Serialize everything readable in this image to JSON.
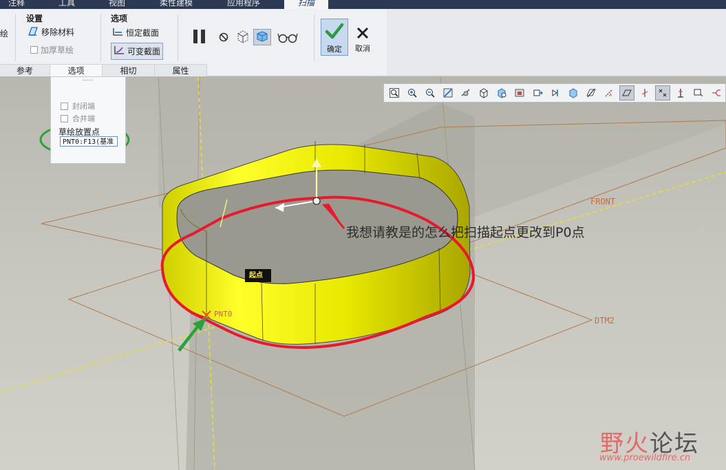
{
  "top_menu": [
    {
      "label": "注释",
      "active": false
    },
    {
      "label": "工具",
      "active": false
    },
    {
      "label": "视图",
      "active": false
    },
    {
      "label": "柔性建模",
      "active": false
    },
    {
      "label": "应用程序",
      "active": false
    },
    {
      "label": "扫描",
      "active": true
    }
  ],
  "ribbon": {
    "left_fragment": "绘",
    "settings": {
      "title": "设置",
      "remove_material": "移除材料",
      "thicken_sketch": "加厚草绘"
    },
    "options": {
      "title": "选项",
      "constant_section": "恒定截面",
      "variable_section": "可变截面"
    },
    "confirm": "确定",
    "cancel": "取消",
    "subtabs": [
      "参考",
      "选项",
      "相切",
      "属性"
    ]
  },
  "options_panel": {
    "handle": "·····",
    "closed_ends": "封闭端",
    "merge_ends": "合并端",
    "sketch_point_label": "草绘放置点",
    "sketch_point_value": "PNT0:F13(基准"
  },
  "viewport": {
    "start_tag": "起点",
    "front_label": "FRONT",
    "dtm2_label": "DTM2",
    "pnt0_label": "PNT0",
    "question": "我想请教是的怎么把扫描起点更改到P0点"
  },
  "view_toolbar_icons": [
    "zoom-fit-icon",
    "zoom-in-icon",
    "zoom-out-icon",
    "repaint-icon",
    "spin-center-icon",
    "shaded-icon",
    "named-views-icon",
    "saved-orientation-icon",
    "cube-view-icon",
    "orient-icon",
    "display-style-icon",
    "plane-display-icon",
    "axis-display-icon",
    "point-display-icon",
    "csys-display-icon",
    "annotation-icon",
    "spin-center-toggle-icon",
    "hidden-line-icon",
    "datum-display-icon",
    "note-icon"
  ],
  "watermark": {
    "brand_red": "野火",
    "brand_gray": "论坛",
    "url": "www.proewildfire.cn"
  },
  "colors": {
    "accent": "#1b6fc4",
    "yellow_part": "#e6e600",
    "annotation_red": "#e8192c",
    "annotation_green": "#2aa23a",
    "datum": "#c0703a"
  }
}
